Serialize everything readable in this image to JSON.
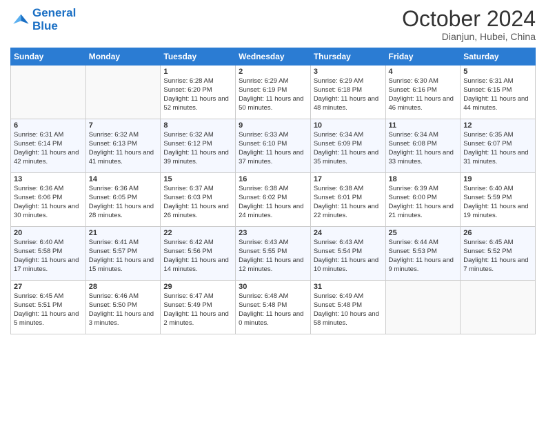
{
  "logo": {
    "line1": "General",
    "line2": "Blue"
  },
  "title": "October 2024",
  "subtitle": "Dianjun, Hubei, China",
  "days_of_week": [
    "Sunday",
    "Monday",
    "Tuesday",
    "Wednesday",
    "Thursday",
    "Friday",
    "Saturday"
  ],
  "weeks": [
    [
      {
        "day": "",
        "sunrise": "",
        "sunset": "",
        "daylight": ""
      },
      {
        "day": "",
        "sunrise": "",
        "sunset": "",
        "daylight": ""
      },
      {
        "day": "1",
        "sunrise": "Sunrise: 6:28 AM",
        "sunset": "Sunset: 6:20 PM",
        "daylight": "Daylight: 11 hours and 52 minutes."
      },
      {
        "day": "2",
        "sunrise": "Sunrise: 6:29 AM",
        "sunset": "Sunset: 6:19 PM",
        "daylight": "Daylight: 11 hours and 50 minutes."
      },
      {
        "day": "3",
        "sunrise": "Sunrise: 6:29 AM",
        "sunset": "Sunset: 6:18 PM",
        "daylight": "Daylight: 11 hours and 48 minutes."
      },
      {
        "day": "4",
        "sunrise": "Sunrise: 6:30 AM",
        "sunset": "Sunset: 6:16 PM",
        "daylight": "Daylight: 11 hours and 46 minutes."
      },
      {
        "day": "5",
        "sunrise": "Sunrise: 6:31 AM",
        "sunset": "Sunset: 6:15 PM",
        "daylight": "Daylight: 11 hours and 44 minutes."
      }
    ],
    [
      {
        "day": "6",
        "sunrise": "Sunrise: 6:31 AM",
        "sunset": "Sunset: 6:14 PM",
        "daylight": "Daylight: 11 hours and 42 minutes."
      },
      {
        "day": "7",
        "sunrise": "Sunrise: 6:32 AM",
        "sunset": "Sunset: 6:13 PM",
        "daylight": "Daylight: 11 hours and 41 minutes."
      },
      {
        "day": "8",
        "sunrise": "Sunrise: 6:32 AM",
        "sunset": "Sunset: 6:12 PM",
        "daylight": "Daylight: 11 hours and 39 minutes."
      },
      {
        "day": "9",
        "sunrise": "Sunrise: 6:33 AM",
        "sunset": "Sunset: 6:10 PM",
        "daylight": "Daylight: 11 hours and 37 minutes."
      },
      {
        "day": "10",
        "sunrise": "Sunrise: 6:34 AM",
        "sunset": "Sunset: 6:09 PM",
        "daylight": "Daylight: 11 hours and 35 minutes."
      },
      {
        "day": "11",
        "sunrise": "Sunrise: 6:34 AM",
        "sunset": "Sunset: 6:08 PM",
        "daylight": "Daylight: 11 hours and 33 minutes."
      },
      {
        "day": "12",
        "sunrise": "Sunrise: 6:35 AM",
        "sunset": "Sunset: 6:07 PM",
        "daylight": "Daylight: 11 hours and 31 minutes."
      }
    ],
    [
      {
        "day": "13",
        "sunrise": "Sunrise: 6:36 AM",
        "sunset": "Sunset: 6:06 PM",
        "daylight": "Daylight: 11 hours and 30 minutes."
      },
      {
        "day": "14",
        "sunrise": "Sunrise: 6:36 AM",
        "sunset": "Sunset: 6:05 PM",
        "daylight": "Daylight: 11 hours and 28 minutes."
      },
      {
        "day": "15",
        "sunrise": "Sunrise: 6:37 AM",
        "sunset": "Sunset: 6:03 PM",
        "daylight": "Daylight: 11 hours and 26 minutes."
      },
      {
        "day": "16",
        "sunrise": "Sunrise: 6:38 AM",
        "sunset": "Sunset: 6:02 PM",
        "daylight": "Daylight: 11 hours and 24 minutes."
      },
      {
        "day": "17",
        "sunrise": "Sunrise: 6:38 AM",
        "sunset": "Sunset: 6:01 PM",
        "daylight": "Daylight: 11 hours and 22 minutes."
      },
      {
        "day": "18",
        "sunrise": "Sunrise: 6:39 AM",
        "sunset": "Sunset: 6:00 PM",
        "daylight": "Daylight: 11 hours and 21 minutes."
      },
      {
        "day": "19",
        "sunrise": "Sunrise: 6:40 AM",
        "sunset": "Sunset: 5:59 PM",
        "daylight": "Daylight: 11 hours and 19 minutes."
      }
    ],
    [
      {
        "day": "20",
        "sunrise": "Sunrise: 6:40 AM",
        "sunset": "Sunset: 5:58 PM",
        "daylight": "Daylight: 11 hours and 17 minutes."
      },
      {
        "day": "21",
        "sunrise": "Sunrise: 6:41 AM",
        "sunset": "Sunset: 5:57 PM",
        "daylight": "Daylight: 11 hours and 15 minutes."
      },
      {
        "day": "22",
        "sunrise": "Sunrise: 6:42 AM",
        "sunset": "Sunset: 5:56 PM",
        "daylight": "Daylight: 11 hours and 14 minutes."
      },
      {
        "day": "23",
        "sunrise": "Sunrise: 6:43 AM",
        "sunset": "Sunset: 5:55 PM",
        "daylight": "Daylight: 11 hours and 12 minutes."
      },
      {
        "day": "24",
        "sunrise": "Sunrise: 6:43 AM",
        "sunset": "Sunset: 5:54 PM",
        "daylight": "Daylight: 11 hours and 10 minutes."
      },
      {
        "day": "25",
        "sunrise": "Sunrise: 6:44 AM",
        "sunset": "Sunset: 5:53 PM",
        "daylight": "Daylight: 11 hours and 9 minutes."
      },
      {
        "day": "26",
        "sunrise": "Sunrise: 6:45 AM",
        "sunset": "Sunset: 5:52 PM",
        "daylight": "Daylight: 11 hours and 7 minutes."
      }
    ],
    [
      {
        "day": "27",
        "sunrise": "Sunrise: 6:45 AM",
        "sunset": "Sunset: 5:51 PM",
        "daylight": "Daylight: 11 hours and 5 minutes."
      },
      {
        "day": "28",
        "sunrise": "Sunrise: 6:46 AM",
        "sunset": "Sunset: 5:50 PM",
        "daylight": "Daylight: 11 hours and 3 minutes."
      },
      {
        "day": "29",
        "sunrise": "Sunrise: 6:47 AM",
        "sunset": "Sunset: 5:49 PM",
        "daylight": "Daylight: 11 hours and 2 minutes."
      },
      {
        "day": "30",
        "sunrise": "Sunrise: 6:48 AM",
        "sunset": "Sunset: 5:48 PM",
        "daylight": "Daylight: 11 hours and 0 minutes."
      },
      {
        "day": "31",
        "sunrise": "Sunrise: 6:49 AM",
        "sunset": "Sunset: 5:48 PM",
        "daylight": "Daylight: 10 hours and 58 minutes."
      },
      {
        "day": "",
        "sunrise": "",
        "sunset": "",
        "daylight": ""
      },
      {
        "day": "",
        "sunrise": "",
        "sunset": "",
        "daylight": ""
      }
    ]
  ]
}
